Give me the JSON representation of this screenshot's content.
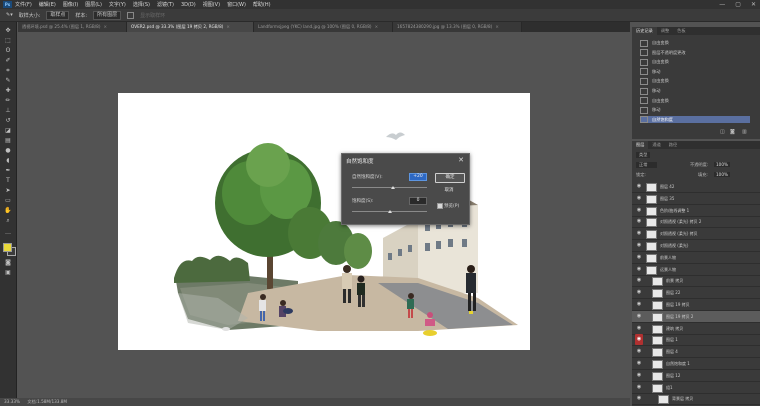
{
  "app": {
    "logo": "Ps"
  },
  "menu": [
    "文件(F)",
    "编辑(E)",
    "图像(I)",
    "图层(L)",
    "文字(Y)",
    "选择(S)",
    "滤镜(T)",
    "3D(D)",
    "视图(V)",
    "窗口(W)",
    "帮助(H)"
  ],
  "window_controls": [
    "—",
    "▢",
    "✕"
  ],
  "options_bar": {
    "sample_size_label": "取样大小:",
    "sample_size_value": "取样点",
    "sample_label": "样本:",
    "sample_value": "所有图层",
    "show_ring_label": "显示取样环"
  },
  "tabs": [
    {
      "label": "透视环境.psd @ 25.4% (图层 1, RGB/8)",
      "active": false
    },
    {
      "label": "OVER2.psd @ 33.3% (图层 19 拷贝 2, RGB/8)",
      "active": true
    },
    {
      "label": "Landformsjpeg (YKC) land.jpg @ 100% (图层 0, RGB/8)",
      "active": false
    },
    {
      "label": "1657824380290.jpg @ 13.3% (图层 0, RGB/8)",
      "active": false
    }
  ],
  "dialog": {
    "title": "自然饱和度",
    "vibrance_label": "自然饱和度(V):",
    "vibrance_value": "+20",
    "saturation_label": "饱和度(S):",
    "saturation_value": "0",
    "vibrance_fraction": 0.55,
    "saturation_fraction": 0.5,
    "ok_label": "确定",
    "cancel_label": "取消",
    "preview_label": "预览(P)"
  },
  "history_panel": {
    "tabs": [
      "历史记录",
      "调整",
      "色板"
    ],
    "items": [
      "自由变换",
      "图层不透明度更改",
      "自由变换",
      "移动",
      "自由变换",
      "移动",
      "自由变换",
      "移动",
      "自然饱和度"
    ],
    "selected_index": 8
  },
  "layers_panel": {
    "tabs": [
      "图层",
      "通道",
      "路径"
    ],
    "filter_label": "类型",
    "blend_mode": "正常",
    "opacity_label": "不透明度:",
    "opacity_value": "100%",
    "lock_label": "锁定:",
    "fill_label": "填充:",
    "fill_value": "100%",
    "layers": [
      {
        "name": "图层 42",
        "indent": 0
      },
      {
        "name": "图层 35",
        "indent": 0
      },
      {
        "name": "色阶/曲线调整 1",
        "indent": 0
      },
      {
        "name": "对照透视 (柔光) 拷贝 2",
        "indent": 0
      },
      {
        "name": "对照透视 (柔光) 拷贝",
        "indent": 0
      },
      {
        "name": "对照透视 (柔光)",
        "indent": 0
      },
      {
        "name": "前景人物",
        "indent": 0
      },
      {
        "name": "远景人物",
        "indent": 0
      },
      {
        "name": "前景 拷贝",
        "indent": 1
      },
      {
        "name": "图层 22",
        "indent": 1
      },
      {
        "name": "图层 19 拷贝",
        "indent": 1
      },
      {
        "name": "图层 19 拷贝 2",
        "indent": 1
      },
      {
        "name": "建筑 拷贝",
        "indent": 1
      },
      {
        "name": "图层 1",
        "indent": 1
      },
      {
        "name": "图层 4",
        "indent": 1
      },
      {
        "name": "自然饱和度 1",
        "indent": 1
      },
      {
        "name": "图层 12",
        "indent": 1
      },
      {
        "name": "组1",
        "indent": 1
      },
      {
        "name": "背景层 拷贝",
        "indent": 2
      }
    ],
    "selected_index": 11
  },
  "status": {
    "zoom": "33.33%",
    "doc": "文档:1.58M/133.8M"
  },
  "colors": {
    "accent": "#2d68c4",
    "selection": "#5a6fa0",
    "canvas_bg": "#535353",
    "fg_swatch": "#e8d83a",
    "bg_swatch": "#3b3b3b"
  }
}
